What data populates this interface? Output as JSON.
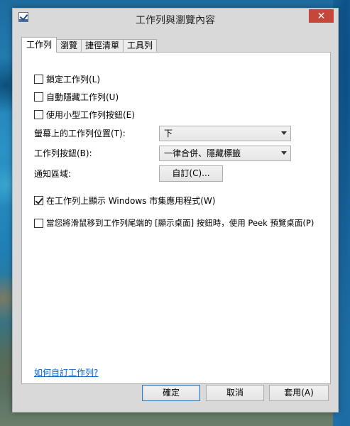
{
  "window": {
    "title": "工作列與瀏覽內容",
    "close_symbol": "✕"
  },
  "tabs": [
    {
      "label": "工作列",
      "active": true
    },
    {
      "label": "瀏覽",
      "active": false
    },
    {
      "label": "捷徑清單",
      "active": false
    },
    {
      "label": "工具列",
      "active": false
    }
  ],
  "taskbar": {
    "lock_taskbar": {
      "label": "鎖定工作列(L)",
      "checked": false
    },
    "auto_hide": {
      "label": "自動隱藏工作列(U)",
      "checked": false
    },
    "small_buttons": {
      "label": "使用小型工作列按鈕(E)",
      "checked": false
    },
    "location": {
      "label": "螢幕上的工作列位置(T):",
      "value": "下"
    },
    "buttons": {
      "label": "工作列按鈕(B):",
      "value": "一律合併、隱藏標籤"
    },
    "notification_area": {
      "label": "通知區域:",
      "button": "自訂(C)..."
    },
    "show_store_apps": {
      "label": "在工作列上顯示 Windows 市集應用程式(W)",
      "checked": true
    },
    "peek": {
      "label": "當您將滑鼠移到工作列尾端的 [顯示桌面] 按鈕時，使用 Peek 預覽桌面(P)",
      "checked": false
    },
    "help_link": "如何自訂工作列?"
  },
  "footer": {
    "ok": "確定",
    "cancel": "取消",
    "apply": "套用(A)"
  }
}
